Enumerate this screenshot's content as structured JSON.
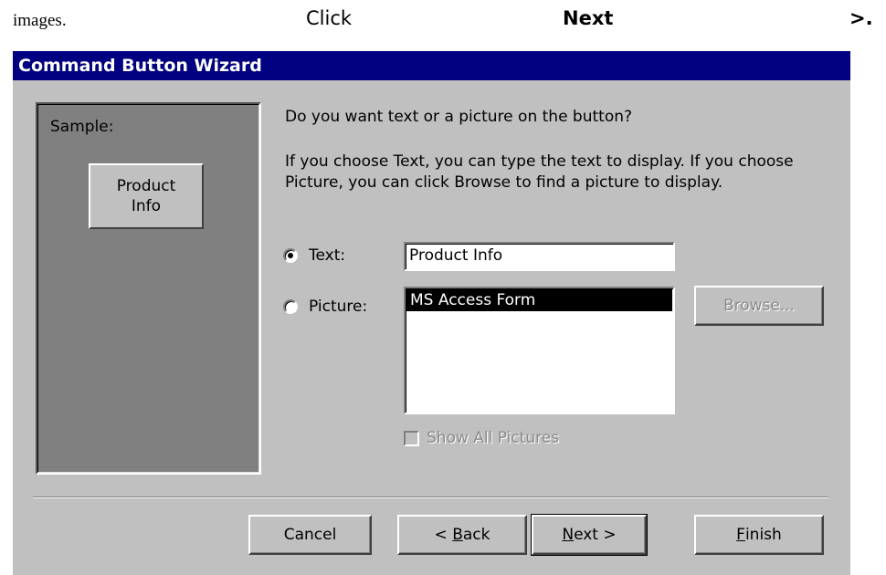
{
  "instruction": {
    "word1": "images.",
    "word2": "Click",
    "word3": "Next",
    "word4": ">."
  },
  "dialog": {
    "title": "Command Button Wizard",
    "sample": {
      "label": "Sample:",
      "button_text": "Product\nInfo"
    },
    "question": "Do you want text or a picture on the button?",
    "help_text": "If you choose Text, you can type the text to display.  If you choose Picture, you can click Browse to find a picture to display.",
    "options": {
      "text_label": "Text:",
      "text_selected": true,
      "text_value": "Product Info",
      "picture_label": "Picture:",
      "picture_selected": false,
      "picture_list": [
        "MS Access Form"
      ],
      "picture_selected_item": "MS Access Form",
      "browse_label": "Browse...",
      "show_all_label": "Show All Pictures",
      "show_all_checked": false
    },
    "buttons": {
      "cancel": "Cancel",
      "back_prefix": "< ",
      "back_mnemonic": "B",
      "back_rest": "ack",
      "next_mnemonic": "N",
      "next_rest": "ext >",
      "finish_mnemonic": "F",
      "finish_rest": "inish"
    }
  },
  "colors": {
    "title_bar": "#000080",
    "dialog_bg": "#c0c0c0",
    "sample_bg": "#808080"
  }
}
